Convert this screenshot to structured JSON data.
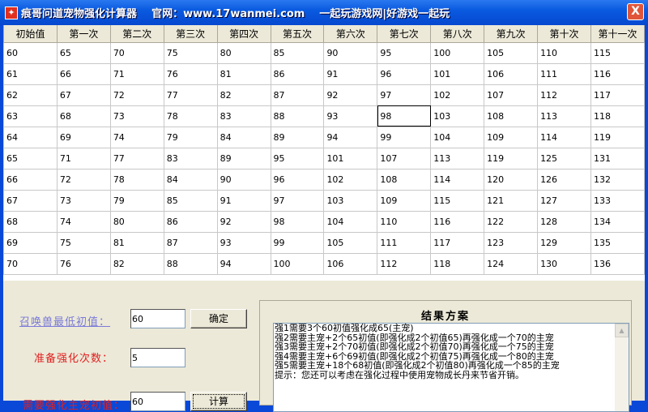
{
  "window": {
    "title": "痕哥问道宠物强化计算器    官网：www.17wanmei.com    一起玩游戏网|好游戏一起玩",
    "close": "X"
  },
  "table": {
    "headers": [
      "初始值",
      "第一次",
      "第二次",
      "第三次",
      "第四次",
      "第五次",
      "第六次",
      "第七次",
      "第八次",
      "第九次",
      "第十次",
      "第十一次"
    ],
    "rows": [
      [
        "60",
        "65",
        "70",
        "75",
        "80",
        "85",
        "90",
        "95",
        "100",
        "105",
        "110",
        "115"
      ],
      [
        "61",
        "66",
        "71",
        "76",
        "81",
        "86",
        "91",
        "96",
        "101",
        "106",
        "111",
        "116"
      ],
      [
        "62",
        "67",
        "72",
        "77",
        "82",
        "87",
        "92",
        "97",
        "102",
        "107",
        "112",
        "117"
      ],
      [
        "63",
        "68",
        "73",
        "78",
        "83",
        "88",
        "93",
        "98",
        "103",
        "108",
        "113",
        "118"
      ],
      [
        "64",
        "69",
        "74",
        "79",
        "84",
        "89",
        "94",
        "99",
        "104",
        "109",
        "114",
        "119"
      ],
      [
        "65",
        "71",
        "77",
        "83",
        "89",
        "95",
        "101",
        "107",
        "113",
        "119",
        "125",
        "131"
      ],
      [
        "66",
        "72",
        "78",
        "84",
        "90",
        "96",
        "102",
        "108",
        "114",
        "120",
        "126",
        "132"
      ],
      [
        "67",
        "73",
        "79",
        "85",
        "91",
        "97",
        "103",
        "109",
        "115",
        "121",
        "127",
        "133"
      ],
      [
        "68",
        "74",
        "80",
        "86",
        "92",
        "98",
        "104",
        "110",
        "116",
        "122",
        "128",
        "134"
      ],
      [
        "69",
        "75",
        "81",
        "87",
        "93",
        "99",
        "105",
        "111",
        "117",
        "123",
        "129",
        "135"
      ],
      [
        "70",
        "76",
        "82",
        "88",
        "94",
        "100",
        "106",
        "112",
        "118",
        "124",
        "130",
        "136"
      ]
    ]
  },
  "form": {
    "min_value_label": "召唤兽最低初值：",
    "min_value": "60",
    "confirm": "确定",
    "times_label": "准备强化次数：",
    "times": "5",
    "third_label": "需要强化主宠初值：",
    "third_value": "60",
    "calc": "计算"
  },
  "result": {
    "title": "结果方案",
    "lines": [
      "强1需要3个60初值强化成65(主宠)",
      "强2需要主宠+2个65初值(即强化成2个初值65)再强化成一个70的主宠",
      "强3需要主宠+2个70初值(即强化成2个初值70)再强化成一个75的主宠",
      "强4需要主宠+6个69初值(即强化成2个初值75)再强化成一个80的主宠",
      "强5需要主宠+18个68初值(即强化成2个初值80)再强化成一个85的主宠",
      "提示：您还可以考虑在强化过程中使用宠物成长丹来节省开销。"
    ]
  }
}
